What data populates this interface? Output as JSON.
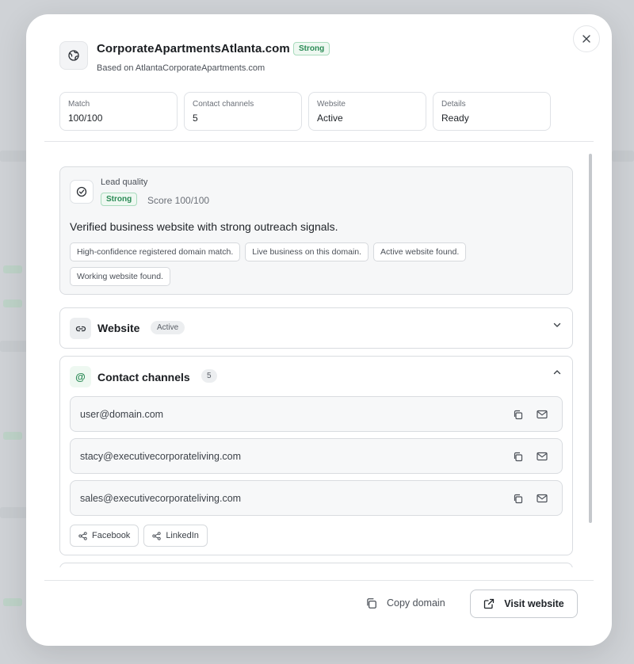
{
  "header": {
    "title": "CorporateApartmentsAtlanta.com",
    "badge": "Strong",
    "subtitle": "Based on AtlantaCorporateApartments.com"
  },
  "stats": [
    {
      "label": "Match",
      "value": "100/100"
    },
    {
      "label": "Contact channels",
      "value": "5"
    },
    {
      "label": "Website",
      "value": "Active"
    },
    {
      "label": "Details",
      "value": "Ready"
    }
  ],
  "lead_quality": {
    "label": "Lead quality",
    "badge": "Strong",
    "score": "Score 100/100",
    "summary": "Verified business website with strong outreach signals.",
    "chips": [
      "High-confidence registered domain match.",
      "Live business on this domain.",
      "Active website found.",
      "Working website found."
    ]
  },
  "website_section": {
    "title": "Website",
    "badge": "Active",
    "icon": "link-icon",
    "expanded": false
  },
  "contacts_section": {
    "title": "Contact channels",
    "count": "5",
    "icon": "at-icon",
    "icon_glyph": "@",
    "expanded": true,
    "emails": [
      "user@domain.com",
      "stacy@executivecorporateliving.com",
      "sales@executivecorporateliving.com"
    ],
    "socials": [
      "Facebook",
      "LinkedIn"
    ]
  },
  "footer": {
    "copy_label": "Copy domain",
    "visit_label": "Visit website"
  },
  "colors": {
    "accent_green": "#2a8a55",
    "badge_green_bg": "#eef8f1",
    "border": "#d9dce0"
  }
}
